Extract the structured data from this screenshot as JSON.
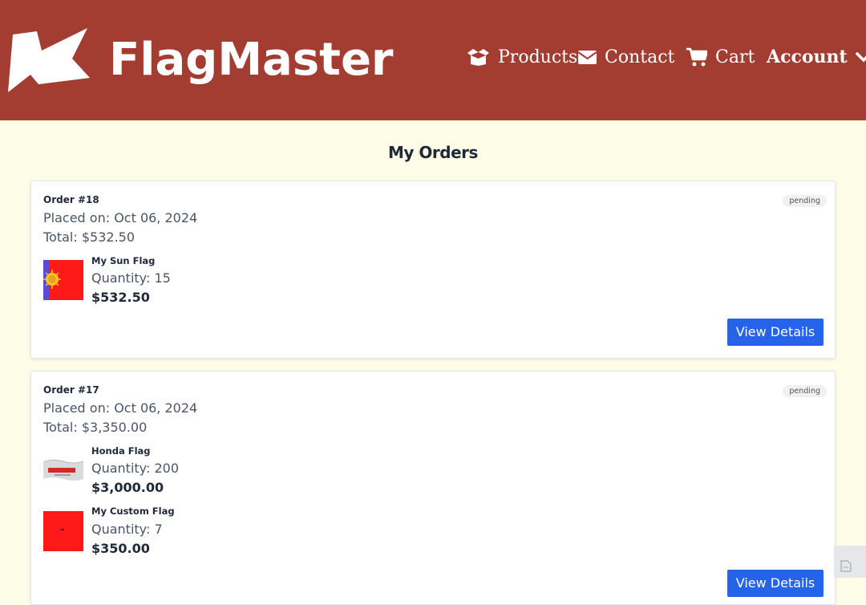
{
  "header": {
    "brand": "FlagMaster",
    "nav": [
      {
        "label": "Products",
        "icon": "box-open-icon"
      },
      {
        "label": "Contact",
        "icon": "envelope-icon"
      },
      {
        "label": "Cart",
        "icon": "cart-icon"
      },
      {
        "label": "Account",
        "icon": "chevron-down-icon"
      }
    ]
  },
  "page": {
    "title": "My Orders"
  },
  "orders": [
    {
      "number": "Order #18",
      "status": "pending",
      "placed": "Placed on: Oct 06, 2024",
      "total": "Total: $532.50",
      "items": [
        {
          "name": "My Sun Flag",
          "quantity": "Quantity: 15",
          "price": "$532.50"
        }
      ],
      "button": "View Details"
    },
    {
      "number": "Order #17",
      "status": "pending",
      "placed": "Placed on: Oct 06, 2024",
      "total": "Total: $3,350.00",
      "items": [
        {
          "name": "Honda Flag",
          "quantity": "Quantity: 200",
          "price": "$3,000.00"
        },
        {
          "name": "My Custom Flag",
          "quantity": "Quantity: 7",
          "price": "$350.00"
        }
      ],
      "button": "View Details"
    }
  ],
  "colors": {
    "header_bg": "#a33d31",
    "page_bg": "#fdfde8",
    "button": "#2563eb"
  }
}
